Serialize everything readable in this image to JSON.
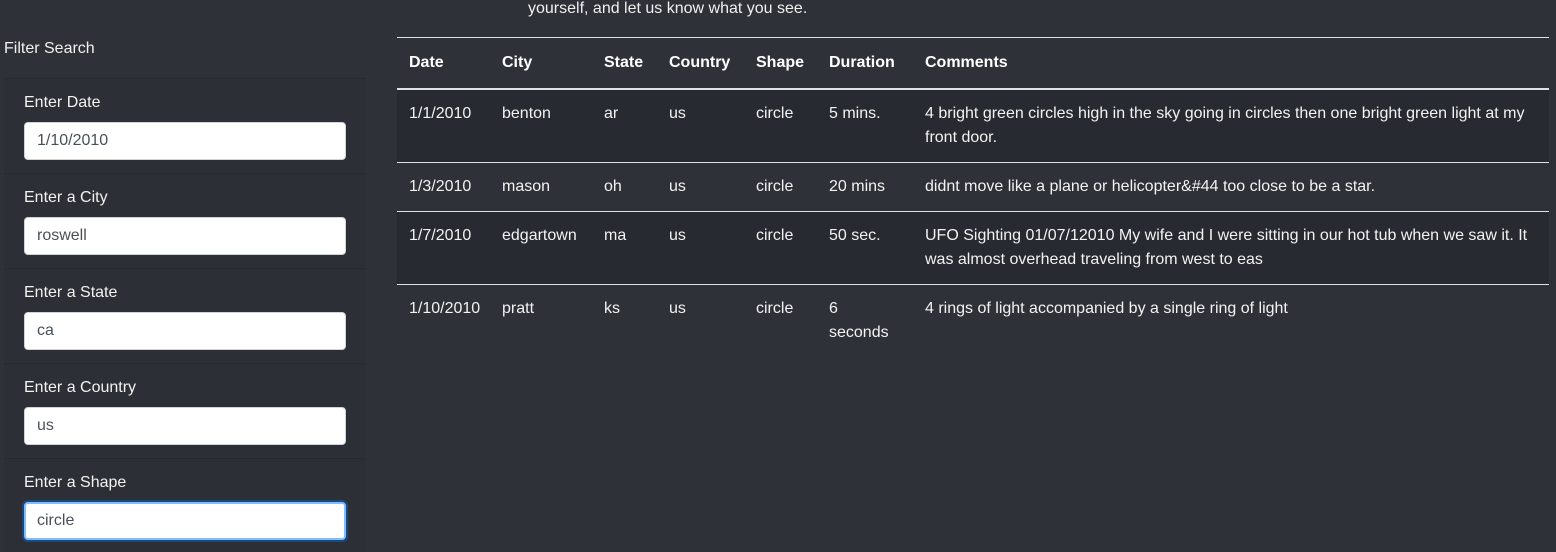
{
  "intro_text": "yourself, and let us know what you see.",
  "filter": {
    "heading": "Filter Search",
    "fields": [
      {
        "label": "Enter Date",
        "value": "1/10/2010"
      },
      {
        "label": "Enter a City",
        "value": "roswell"
      },
      {
        "label": "Enter a State",
        "value": "ca"
      },
      {
        "label": "Enter a Country",
        "value": "us"
      },
      {
        "label": "Enter a Shape",
        "value": "circle"
      }
    ]
  },
  "table": {
    "headers": [
      "Date",
      "City",
      "State",
      "Country",
      "Shape",
      "Duration",
      "Comments"
    ],
    "rows": [
      [
        "1/1/2010",
        "benton",
        "ar",
        "us",
        "circle",
        "5 mins.",
        "4 bright green circles high in the sky going in circles then one bright green light at my front door."
      ],
      [
        "1/3/2010",
        "mason",
        "oh",
        "us",
        "circle",
        "20 mins",
        "didnt move like a plane or helicopter&#44 too close to be a star."
      ],
      [
        "1/7/2010",
        "edgartown",
        "ma",
        "us",
        "circle",
        "50 sec.",
        "UFO Sighting 01/07/12010 My wife and I were sitting in our hot tub when we saw it. It was almost overhead traveling from west to eas"
      ],
      [
        "1/10/2010",
        "pratt",
        "ks",
        "us",
        "circle",
        "6 seconds",
        "4 rings of light accompanied by a single ring of light"
      ]
    ]
  }
}
